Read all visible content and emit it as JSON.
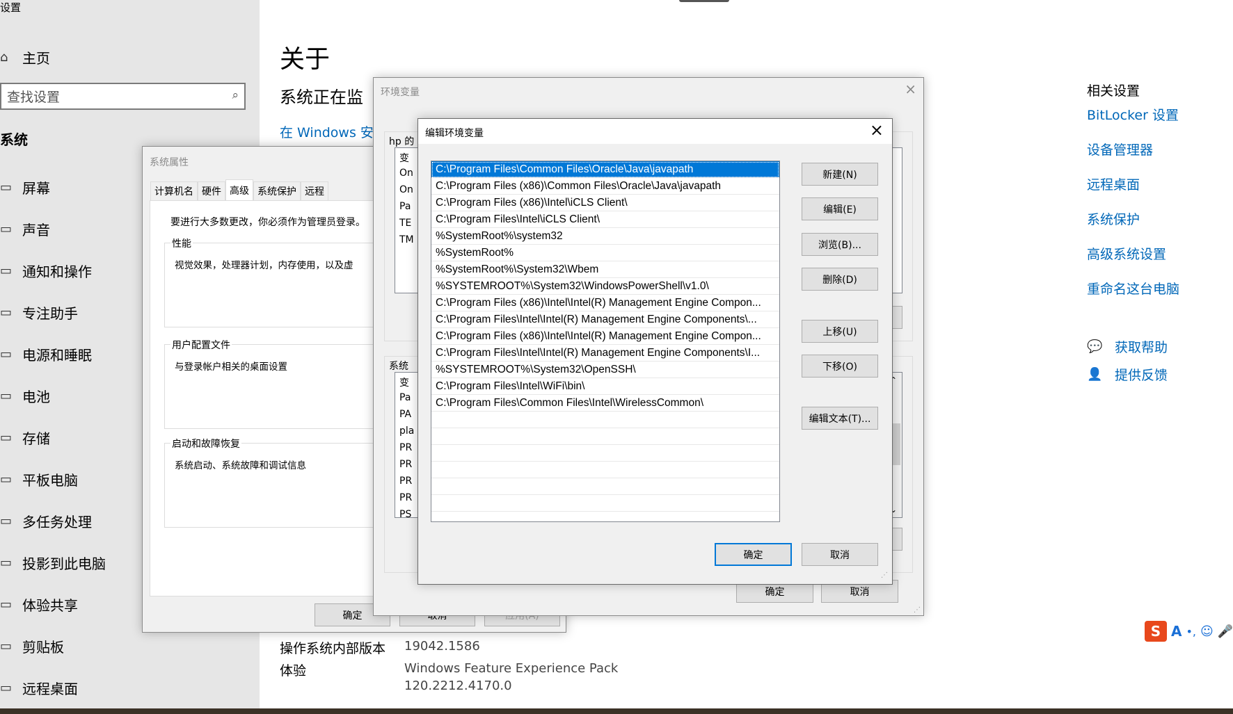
{
  "settings": {
    "window_title": "设置",
    "home": "主页",
    "search_placeholder": "查找设置",
    "section": "系统",
    "nav": [
      {
        "label": "屏幕",
        "icon": "monitor-icon"
      },
      {
        "label": "声音",
        "icon": "speaker-icon"
      },
      {
        "label": "通知和操作",
        "icon": "notification-icon"
      },
      {
        "label": "专注助手",
        "icon": "moon-icon"
      },
      {
        "label": "电源和睡眠",
        "icon": "power-icon"
      },
      {
        "label": "电池",
        "icon": "battery-icon"
      },
      {
        "label": "存储",
        "icon": "storage-icon"
      },
      {
        "label": "平板电脑",
        "icon": "tablet-icon"
      },
      {
        "label": "多任务处理",
        "icon": "multitask-icon"
      },
      {
        "label": "投影到此电脑",
        "icon": "project-icon"
      },
      {
        "label": "体验共享",
        "icon": "share-icon"
      },
      {
        "label": "剪贴板",
        "icon": "clipboard-icon"
      },
      {
        "label": "远程桌面",
        "icon": "remote-icon"
      }
    ]
  },
  "about": {
    "title": "关于",
    "subtitle": "系统正在监",
    "link": "在 Windows 安全",
    "os_build_key": "操作系统内部版本",
    "os_build_val": "19042.1586",
    "experience_key": "体验",
    "experience_val1": "Windows Feature Experience Pack",
    "experience_val2": "120.2212.4170.0"
  },
  "related": {
    "heading": "相关设置",
    "links": [
      "BitLocker 设置",
      "设备管理器",
      "远程桌面",
      "系统保护",
      "高级系统设置",
      "重命名这台电脑"
    ],
    "help": "获取帮助",
    "feedback": "提供反馈"
  },
  "sysprops": {
    "title": "系统属性",
    "tabs": [
      "计算机名",
      "硬件",
      "高级",
      "系统保护",
      "远程"
    ],
    "admin_note": "要进行大多数更改，你必须作为管理员登录。",
    "perf_label": "性能",
    "perf_desc": "视觉效果，处理器计划，内存使用，以及虚",
    "profile_label": "用户配置文件",
    "profile_desc": "与登录帐户相关的桌面设置",
    "startup_label": "启动和故障恢复",
    "startup_desc": "系统启动、系统故障和调试信息",
    "ok": "确定",
    "cancel": "取消",
    "apply": "应用(A)"
  },
  "envvars": {
    "title": "环境变量",
    "user_label": "hp 的",
    "user_rows": [
      "变",
      "On",
      "On",
      "Pa",
      "TE",
      "TM"
    ],
    "sys_label": "系统",
    "sys_rows": [
      "变",
      "Pa",
      "PA",
      "pla",
      "PR",
      "PR",
      "PR",
      "PR",
      "PS"
    ],
    "ok": "确定",
    "cancel": "取消"
  },
  "editenv": {
    "title": "编辑环境变量",
    "entries": [
      "C:\\Program Files\\Common Files\\Oracle\\Java\\javapath",
      "C:\\Program Files (x86)\\Common Files\\Oracle\\Java\\javapath",
      "C:\\Program Files (x86)\\Intel\\iCLS Client\\",
      "C:\\Program Files\\Intel\\iCLS Client\\",
      "%SystemRoot%\\system32",
      "%SystemRoot%",
      "%SystemRoot%\\System32\\Wbem",
      "%SYSTEMROOT%\\System32\\WindowsPowerShell\\v1.0\\",
      "C:\\Program Files (x86)\\Intel\\Intel(R) Management Engine Compon...",
      "C:\\Program Files\\Intel\\Intel(R) Management Engine Components\\...",
      "C:\\Program Files (x86)\\Intel\\Intel(R) Management Engine Compon...",
      "C:\\Program Files\\Intel\\Intel(R) Management Engine Components\\I...",
      "%SYSTEMROOT%\\System32\\OpenSSH\\",
      "C:\\Program Files\\Intel\\WiFi\\bin\\",
      "C:\\Program Files\\Common Files\\Intel\\WirelessCommon\\"
    ],
    "selected_index": 0,
    "buttons": {
      "new": "新建(N)",
      "edit": "编辑(E)",
      "browse": "浏览(B)...",
      "delete": "删除(D)",
      "up": "上移(U)",
      "down": "下移(O)",
      "edit_text": "编辑文本(T)..."
    },
    "ok": "确定",
    "cancel": "取消"
  },
  "ime": {
    "logo": "S",
    "mode": "A"
  }
}
